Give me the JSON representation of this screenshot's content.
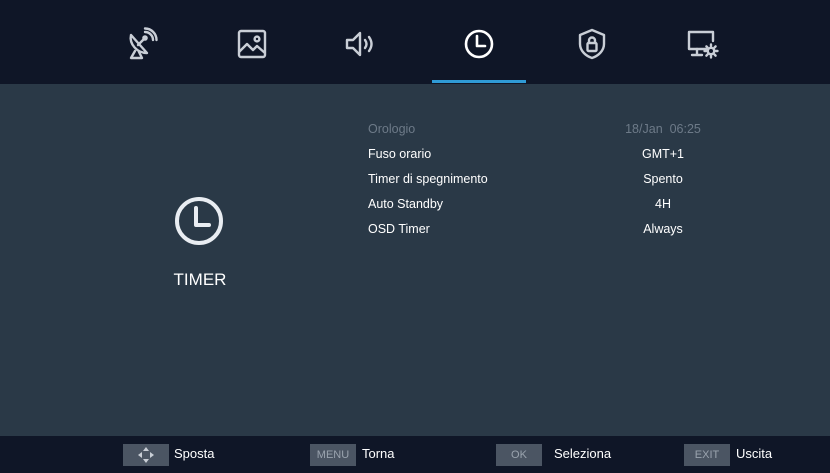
{
  "tabs": [
    {
      "icon": "satellite-dish-icon",
      "selected": false
    },
    {
      "icon": "picture-icon",
      "selected": false
    },
    {
      "icon": "speaker-icon",
      "selected": false
    },
    {
      "icon": "clock-icon",
      "selected": true
    },
    {
      "icon": "lock-shield-icon",
      "selected": false
    },
    {
      "icon": "monitor-settings-icon",
      "selected": false
    }
  ],
  "colors": {
    "accent": "#2f9bd6",
    "topbar_bg": "#0f1627",
    "main_bg": "#2a3947",
    "disabled_text": "#6d7a88"
  },
  "section": {
    "title": "TIMER",
    "icon": "clock-icon"
  },
  "menu": [
    {
      "label": "Orologio",
      "value": "18/Jan  06:25",
      "disabled": true
    },
    {
      "label": "Fuso orario",
      "value": "GMT+1",
      "disabled": false
    },
    {
      "label": "Timer di spegnimento",
      "value": "Spento",
      "disabled": false
    },
    {
      "label": "Auto Standby",
      "value": "4H",
      "disabled": false
    },
    {
      "label": "OSD Timer",
      "value": "Always",
      "disabled": false
    }
  ],
  "footer": {
    "move": {
      "key_icon": "dpad-icon",
      "label": "Sposta"
    },
    "back": {
      "key": "MENU",
      "label": "Torna"
    },
    "select": {
      "key": "OK",
      "label": "Seleziona"
    },
    "exit": {
      "key": "EXIT",
      "label": "Uscita"
    }
  }
}
